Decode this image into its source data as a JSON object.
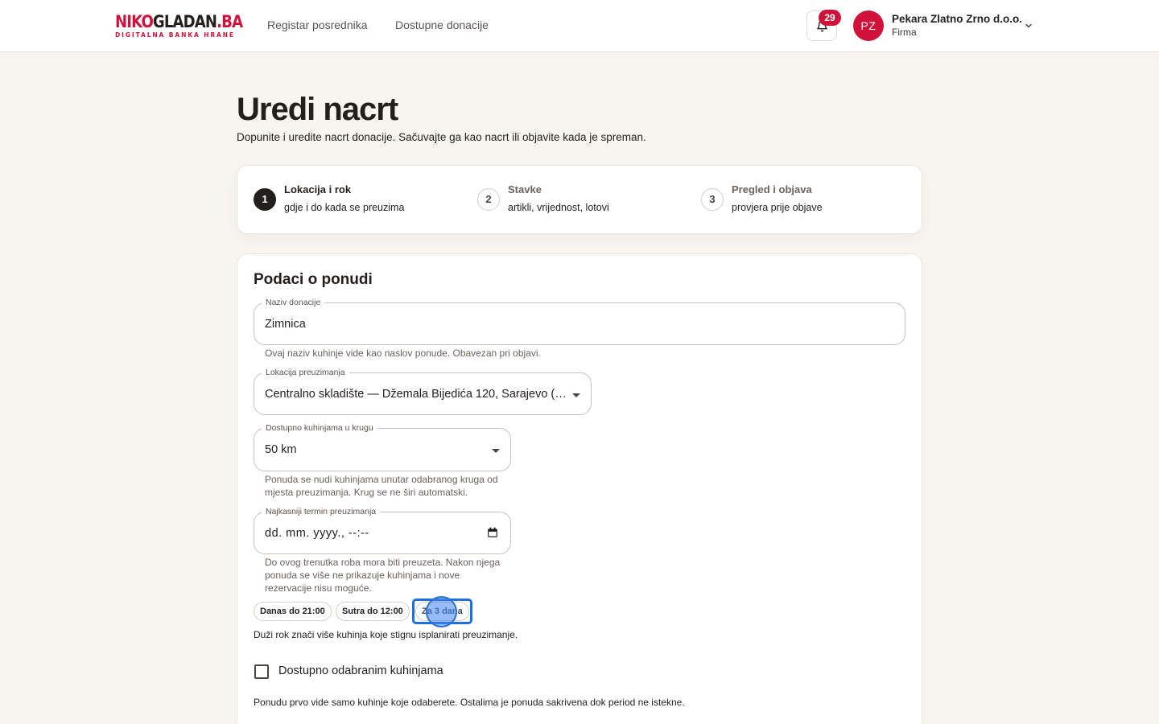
{
  "brand": {
    "logo_part1": "NIKO",
    "logo_part2": "GLADAN",
    "logo_part3": ".BA",
    "tagline": "DIGITALNA BANKA HRANE",
    "accent_color": "#d0123b"
  },
  "nav": {
    "links": [
      "Registar posrednika",
      "Dostupne donacije"
    ]
  },
  "header": {
    "notifications_count": "29",
    "user_initials": "PZ",
    "user_name": "Pekara Zlatno Zrno d.o.o.",
    "user_role": "Firma"
  },
  "page": {
    "title": "Uredi nacrt",
    "subtitle": "Dopunite i uredite nacrt donacije. Sačuvajte ga kao nacrt ili objavite kada je spreman."
  },
  "stepper": {
    "active_step": 1,
    "steps": [
      {
        "num": "1",
        "title": "Lokacija i rok",
        "desc": "gdje i do kada se preuzima"
      },
      {
        "num": "2",
        "title": "Stavke",
        "desc": "artikli, vrijednost, lotovi"
      },
      {
        "num": "3",
        "title": "Pregled i objava",
        "desc": "provjera prije objave"
      }
    ]
  },
  "form": {
    "section_title": "Podaci o ponudi",
    "name": {
      "label": "Naziv donacije",
      "value": "Zimnica",
      "helper": "Ovaj naziv kuhinje vide kao naslov ponude. Obavezan pri objavi."
    },
    "location": {
      "label": "Lokacija preuzimanja",
      "value": "Centralno skladište — Džemala Bijedića 120, Sarajevo (Z..."
    },
    "radius": {
      "label": "Dostupno kuhinjama u krugu",
      "value": "50 km",
      "helper": "Ponuda se nudi kuhinjama unutar odabranog kruga od mjesta preuzimanja. Krug se ne širi automatski."
    },
    "deadline": {
      "label": "Najkasniji termin preuzimanja",
      "value": "dd. mm. yyyy., --:--",
      "helper": "Do ovog trenutka roba mora biti preuzeta. Nakon njega ponuda se više ne prikazuje kuhinjama i nove rezervacije nisu moguće."
    },
    "quick_chips": [
      "Danas do 21:00",
      "Sutra do 12:00",
      "Za 3 dana"
    ],
    "focused_chip": "Za 3 dana",
    "deadline_note": "Duži rok znači više kuhinja koje stignu isplanirati preuzimanje.",
    "selected_kitchens": {
      "label": "Dostupno odabranim kuhinjama",
      "checked": false,
      "note": "Ponudu prvo vide samo kuhinje koje odaberete. Ostalima je ponuda sakrivena dok period ne istekne."
    }
  }
}
